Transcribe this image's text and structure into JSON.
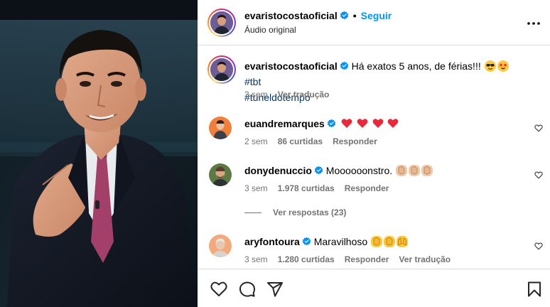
{
  "post": {
    "username": "evaristocostaoficial",
    "separator": "•",
    "follow_label": "Seguir",
    "audio_label": "Áudio original",
    "more_label": "•••"
  },
  "caption": {
    "username": "evaristocostaoficial",
    "text": "Há exatos 5 anos, de férias!!!",
    "hashtag_1": "#tbt",
    "hashtag_2": "#tuneldotempo",
    "time": "3 sem",
    "translate_label": "Ver tradução"
  },
  "comments": [
    {
      "username": "euandremarques",
      "text": "",
      "time": "2 sem",
      "likes": "86 curtidas",
      "reply_label": "Responder"
    },
    {
      "username": "donydenuccio",
      "text": "Moooooonstro.",
      "time": "3 sem",
      "likes": "1.978 curtidas",
      "reply_label": "Responder",
      "view_replies": "Ver respostas (23)"
    },
    {
      "username": "aryfontoura",
      "text": "Maravilhoso",
      "time": "3 sem",
      "likes": "1.280 curtidas",
      "reply_label": "Responder",
      "translate_label": "Ver tradução"
    }
  ],
  "icons": {
    "verified": "verified-badge-icon",
    "like": "heart-outline-icon",
    "comment": "comment-bubble-icon",
    "share": "paper-plane-icon",
    "save": "bookmark-icon"
  },
  "colors": {
    "link_blue": "#0095f6",
    "hashtag": "#00376b",
    "muted": "#737373",
    "divider": "#dbdbdb"
  }
}
